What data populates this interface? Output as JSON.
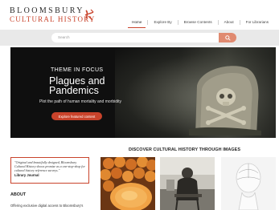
{
  "brand": {
    "line1": "BLOOMSBURY",
    "line2": "CULTURAL HISTORY",
    "accent_color": "#c9432b"
  },
  "nav": {
    "items": [
      "Home",
      "Explore By",
      "Browse Contents",
      "About",
      "For Librarians"
    ],
    "active": "Home"
  },
  "search": {
    "placeholder": "Search",
    "button_icon": "search-icon"
  },
  "hero": {
    "kicker": "THEME IN FOCUS",
    "title": "Plagues and Pandemics",
    "subtitle": "Plot the path of human mortality and morbidity",
    "cta_label": "Explore featured content"
  },
  "images_section": {
    "heading": "DISCOVER CULTURAL HISTORY THROUGH IMAGES"
  },
  "testimonial": {
    "quote": "\"Original and beautifully designed, Bloomsbury Cultural History shows promise as a one-stop-shop for cultural history reference surveys.\"",
    "source": "Library Journal"
  },
  "about": {
    "heading": "ABOUT",
    "text": "Offering exclusive digital access to Bloomsbury's"
  }
}
